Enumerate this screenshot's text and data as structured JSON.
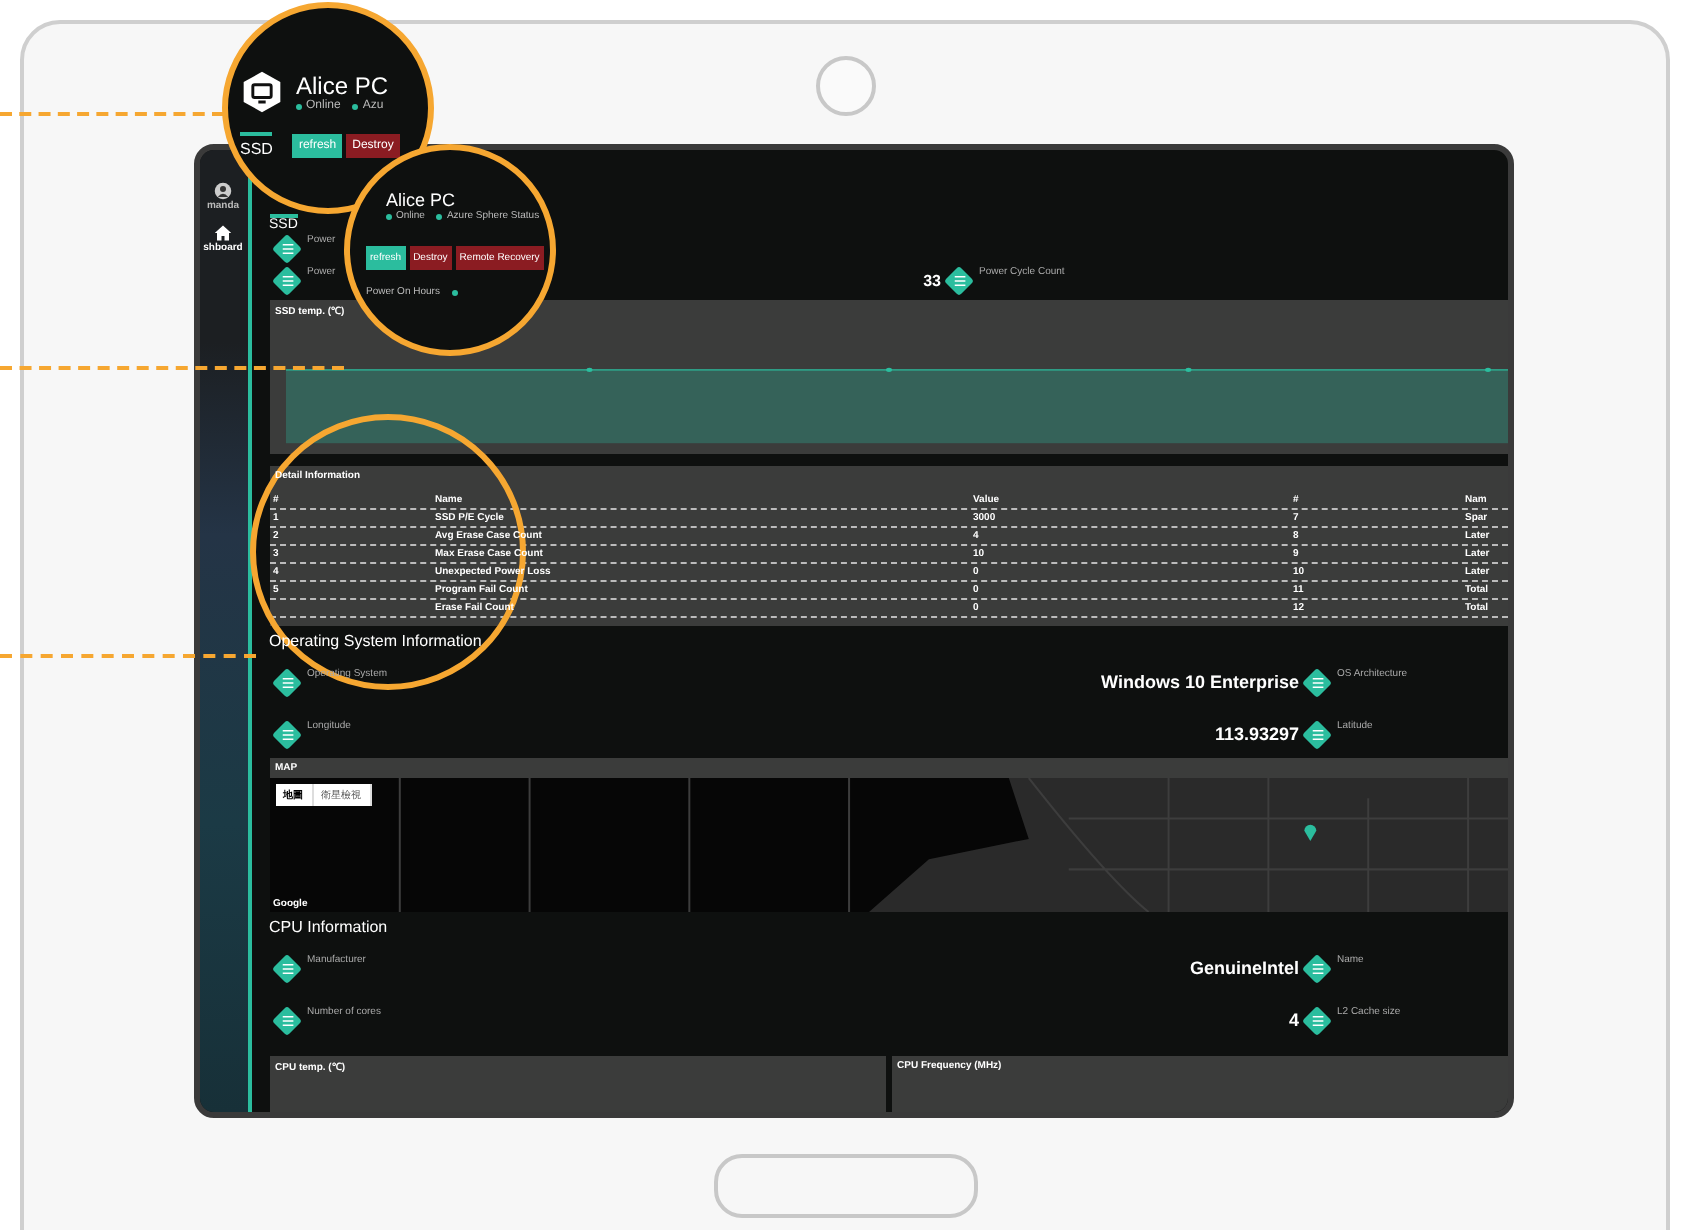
{
  "sidebar": {
    "items": [
      {
        "label": "manda",
        "kind": "user",
        "selected": false
      },
      {
        "label": "shboard",
        "kind": "home",
        "selected": true
      }
    ]
  },
  "overview": {
    "tab": "SSD",
    "rows": [
      {
        "label": "Power"
      },
      {
        "label": "Power",
        "value": "33",
        "right_label": "Power Cycle Count"
      }
    ]
  },
  "ssd_chart": {
    "title": "SSD temp. (℃)"
  },
  "detail": {
    "title": "Detail Information",
    "columns": [
      "#",
      "Name",
      "Value",
      "#",
      "Nam"
    ],
    "rows": [
      [
        "1",
        "SSD P/E Cycle",
        "3000",
        "7",
        "Spar"
      ],
      [
        "2",
        "Avg Erase Case Count",
        "4",
        "8",
        "Later"
      ],
      [
        "3",
        "Max Erase Case Count",
        "10",
        "9",
        "Later"
      ],
      [
        "4",
        "Unexpected Power Loss",
        "0",
        "10",
        "Later"
      ],
      [
        "5",
        "Program Fail Count",
        "0",
        "11",
        "Total"
      ],
      [
        "",
        "Erase Fail Count",
        "0",
        "12",
        "Total"
      ]
    ]
  },
  "os": {
    "title": "Operating System Information",
    "rows": [
      {
        "label": "Operating System",
        "value": "Windows 10 Enterprise",
        "right_label": "OS Architecture"
      },
      {
        "label": "Longitude",
        "value": "113.93297",
        "right_label": "Latitude"
      }
    ]
  },
  "map": {
    "title": "MAP",
    "buttons": [
      {
        "label": "地圖",
        "selected": true
      },
      {
        "label": "衛星檢視",
        "selected": false
      }
    ],
    "attribution": "Google"
  },
  "cpu": {
    "title": "CPU Information",
    "rows": [
      {
        "label": "Manufacturer",
        "value": "GenuineIntel",
        "right_label": "Name"
      },
      {
        "label": "Number of cores",
        "value": "4",
        "right_label": "L2 Cache size"
      }
    ]
  },
  "cpu_charts": [
    {
      "title": "CPU temp. (℃)"
    },
    {
      "title": "CPU Frequency (MHz)"
    }
  ],
  "callouts": [
    {
      "title": "Alice PC",
      "statuses": [
        "Online",
        "Azu"
      ],
      "tab": "SSD",
      "buttons": [
        {
          "label": "refresh",
          "kind": "primary"
        },
        {
          "label": "Destroy",
          "kind": "danger"
        }
      ]
    },
    {
      "title": "Alice PC",
      "statuses": [
        "Online",
        "Azure Sphere Status"
      ],
      "buttons": [
        {
          "label": "refresh",
          "kind": "primary"
        },
        {
          "label": "Destroy",
          "kind": "danger"
        },
        {
          "label": "Remote Recovery",
          "kind": "danger"
        }
      ],
      "field": "Power On Hours"
    }
  ]
}
